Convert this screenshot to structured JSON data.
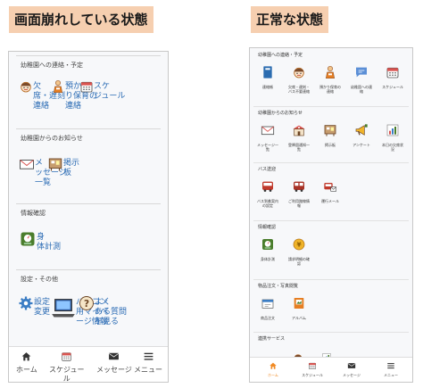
{
  "captions": {
    "left": "画面崩れしている状態",
    "right": "正常な状態"
  },
  "broken": {
    "sections": [
      {
        "title": "幼稚園への連絡・予定",
        "items": [
          {
            "icon": "face-icon",
            "label": "欠\n席・遅刻\n連絡"
          },
          {
            "icon": "child-icon",
            "label": "預か\nり保育の\n連絡"
          },
          {
            "icon": "calendar-icon",
            "label": "スケ\nジュール"
          }
        ]
      },
      {
        "title": "幼稚園からのお知らせ",
        "items": [
          {
            "icon": "envelope-icon",
            "label": "メ\nッセージ\n一覧"
          },
          {
            "icon": "board-icon",
            "label": "掲示\n板"
          }
        ]
      },
      {
        "title": "情報確認",
        "items": [
          {
            "icon": "scale-icon",
            "label": "身\n体計測"
          }
        ]
      },
      {
        "title": "設定・その他",
        "items": [
          {
            "icon": "gear-icon",
            "label": "設定\n変更"
          },
          {
            "icon": "laptop-icon",
            "label": "パソコン\n用マイペ\nージ情報"
          },
          {
            "icon": "question-icon",
            "label": "よく\nある質問\nを見る"
          }
        ]
      }
    ],
    "nav": [
      {
        "icon": "home-icon",
        "label": "ホーム"
      },
      {
        "icon": "calendar-icon",
        "label": "スケジュー\nル"
      },
      {
        "icon": "mail-icon",
        "label": "メッセージ"
      },
      {
        "icon": "menu-icon",
        "label": "メニュー"
      }
    ]
  },
  "normal": {
    "sections": [
      {
        "title": "幼稚園への連絡・予定",
        "items": [
          {
            "icon": "notebook-icon",
            "label": "連絡帳"
          },
          {
            "icon": "face-icon",
            "label": "欠席・遅刻・\nバス不要連絡"
          },
          {
            "icon": "child-icon",
            "label": "預かり保育の\n連絡"
          },
          {
            "icon": "chat-icon",
            "label": "幼稚園への連\n絡"
          },
          {
            "icon": "calendar-icon",
            "label": "スケジュール"
          }
        ]
      },
      {
        "title": "幼稚園からのお知らせ",
        "items": [
          {
            "icon": "envelope-icon",
            "label": "メッセージ一\n覧"
          },
          {
            "icon": "school-icon",
            "label": "登降園通知一\n覧"
          },
          {
            "icon": "board-icon",
            "label": "掲示板"
          },
          {
            "icon": "megaphone-icon",
            "label": "アンケート"
          },
          {
            "icon": "bar-chart-icon",
            "label": "本日の欠席状\n況"
          }
        ]
      },
      {
        "title": "バス送迎",
        "items": [
          {
            "icon": "bus-icon",
            "label": "バス到着案内\nの設定"
          },
          {
            "icon": "bus-route-icon",
            "label": "ご利用路線情\n報"
          },
          {
            "icon": "bus-mail-icon",
            "label": "運行メール"
          }
        ]
      },
      {
        "title": "情報確認",
        "items": [
          {
            "icon": "scale-icon",
            "label": "身体計測"
          },
          {
            "icon": "coin-icon",
            "label": "請求明細の確\n認"
          }
        ]
      },
      {
        "title": "物品注文・写真閲覧",
        "items": [
          {
            "icon": "cart-icon",
            "label": "商品注文"
          },
          {
            "icon": "album-icon",
            "label": "アルバム"
          }
        ]
      },
      {
        "title": "連携サービス",
        "items": []
      }
    ],
    "nav": [
      {
        "icon": "home-icon",
        "label": "ホーム",
        "active": true
      },
      {
        "icon": "calendar-icon",
        "label": "スケジュール"
      },
      {
        "icon": "mail-icon",
        "label": "メッセージ"
      },
      {
        "icon": "menu-icon",
        "label": "メニュー"
      }
    ]
  }
}
